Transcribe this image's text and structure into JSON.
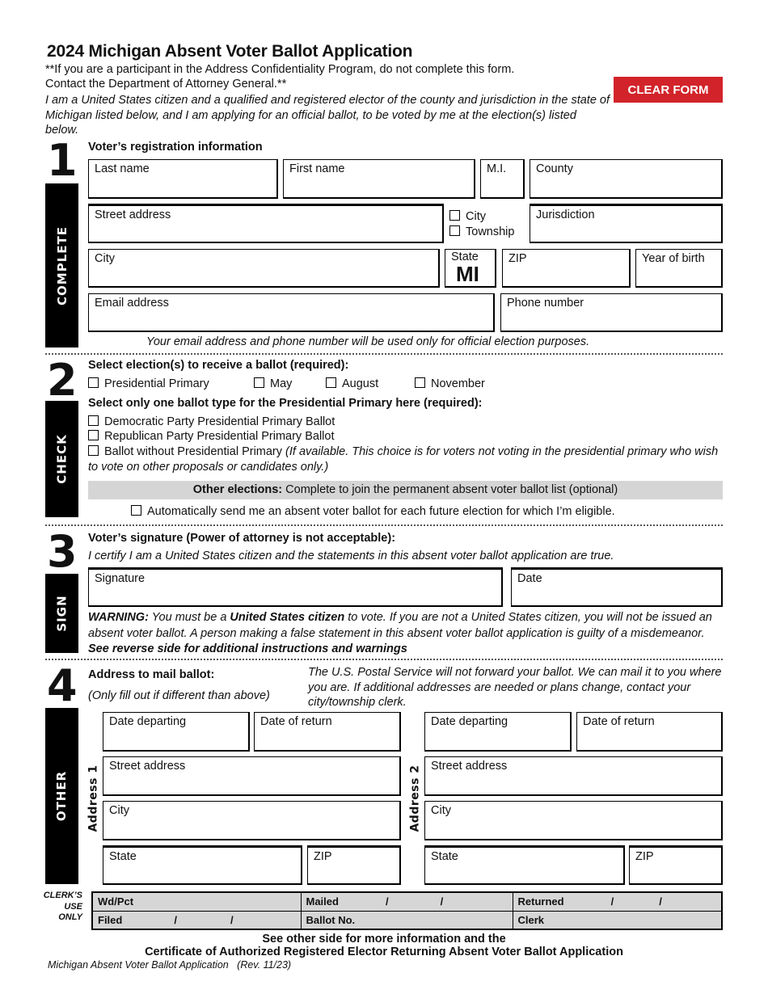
{
  "header": {
    "title": "2024 Michigan Absent Voter Ballot Application",
    "note_line1": "**If you are a participant in the Address Confidentiality Program, do not complete this form.",
    "note_line2": "Contact the Department of Attorney General.**",
    "intro": "I am a United States citizen and a qualified and registered elector of the county and jurisdiction in the state of Michigan listed below, and I am applying for an official ballot, to be voted by me at the election(s) listed below.",
    "clear_button": "CLEAR FORM",
    "clear_button_color": "#d2232a"
  },
  "section1": {
    "number": "1",
    "side_label": "COMPLETE",
    "heading": "Voter’s registration information",
    "fields": {
      "last_name": "Last name",
      "first_name": "First name",
      "mi": "M.I.",
      "county": "County",
      "street": "Street address",
      "city_option": "City",
      "township_option": "Township",
      "jurisdiction": "Jurisdiction",
      "city": "City",
      "state_label": "State",
      "state_value": "MI",
      "zip": "ZIP",
      "year_of_birth": "Year of birth",
      "email": "Email address",
      "phone": "Phone number"
    },
    "privacy_note": "Your email address and phone number will be used only for official election purposes."
  },
  "section2": {
    "number": "2",
    "side_label": "CHECK",
    "heading_elections": "Select election(s) to receive a ballot (required):",
    "elections": [
      "Presidential Primary",
      "May",
      "August",
      "November"
    ],
    "heading_ballot": "Select only one ballot type for the Presidential Primary here (required):",
    "ballot_types": [
      "Democratic Party Presidential Primary Ballot",
      "Republican Party Presidential Primary Ballot",
      "Ballot without Presidential Primary"
    ],
    "ballot_without_note": "(If available. This choice is for voters not voting in the presidential primary who wish to vote on other proposals or candidates only.)",
    "other_bold": "Other elections:",
    "other_text": " Complete to join the permanent absent voter ballot list (optional)",
    "auto_send": "Automatically send me an absent voter ballot for each future election for which I’m eligible."
  },
  "section3": {
    "number": "3",
    "side_label": "SIGN",
    "heading": "Voter’s signature (Power of attorney is not acceptable):",
    "certify": "I certify I am a United States citizen and the statements in this absent voter ballot application are true.",
    "signature": "Signature",
    "date": "Date",
    "warning_label": "WARNING:",
    "warning_1": " You must be a ",
    "warning_citizen": "United States citizen",
    "warning_2": " to vote. If you are not a United States citizen, you will not be issued an absent voter ballot. A person making a false statement in this absent voter ballot application is guilty of a misdemeanor. ",
    "warning_reverse": "See reverse side for additional instructions and warnings"
  },
  "section4": {
    "number": "4",
    "side_label": "OTHER",
    "heading": "Address to mail ballot:",
    "subheading": "(Only fill out if different than above)",
    "postal_note": "The U.S. Postal Service will not forward your ballot. We can mail it to you where you are. If additional addresses are needed or plans change, contact your city/township clerk.",
    "addresses": [
      {
        "label": "Address 1",
        "date_departing": "Date departing",
        "date_return": "Date of return",
        "street": "Street address",
        "city": "City",
        "state": "State",
        "zip": "ZIP"
      },
      {
        "label": "Address 2",
        "date_departing": "Date departing",
        "date_return": "Date of return",
        "street": "Street address",
        "city": "City",
        "state": "State",
        "zip": "ZIP"
      }
    ]
  },
  "clerk": {
    "label_1": "CLERK’S",
    "label_2": "USE",
    "label_3": "ONLY",
    "wdpct": "Wd/Pct",
    "mailed": "Mailed",
    "returned": "Returned",
    "filed": "Filed",
    "ballot_no": "Ballot No.",
    "clerk": "Clerk",
    "slash": "/"
  },
  "footer": {
    "line1": "See other side for more information and the",
    "line2": "Certificate of Authorized Registered Elector Returning Absent Voter Ballot Application",
    "form_name": "Michigan Absent Voter Ballot Application   (Rev. 11/23)"
  }
}
